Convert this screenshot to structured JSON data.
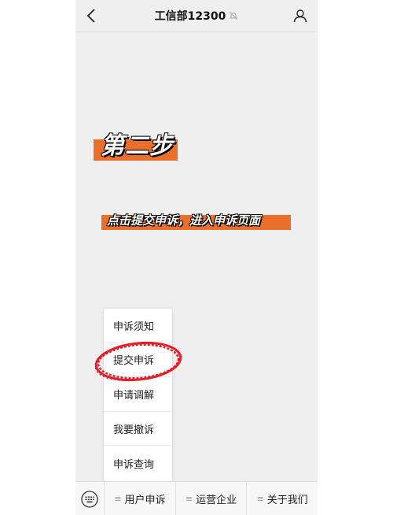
{
  "header": {
    "title": "工信部12300",
    "back_icon": "chevron-left-icon",
    "mute_icon": "bell-mute-icon",
    "profile_icon": "person-icon"
  },
  "overlay": {
    "step_label": "第二步",
    "instruction": "点击提交申诉，进入申诉页面"
  },
  "popup_menu": {
    "items": [
      "申诉须知",
      "提交申诉",
      "申请调解",
      "我要撤诉",
      "申诉查询"
    ],
    "highlighted": "提交申诉"
  },
  "bottom_bar": {
    "keyboard_icon": "keyboard-icon",
    "tabs": [
      {
        "label": "用户申诉",
        "icon": "menu-lines-icon"
      },
      {
        "label": "运营企业",
        "icon": "menu-lines-icon"
      },
      {
        "label": "关于我们",
        "icon": "menu-lines-icon"
      }
    ]
  },
  "colors": {
    "banner": "#ea6f2b",
    "highlight_circle": "#e0202a",
    "background": "#efefef"
  }
}
